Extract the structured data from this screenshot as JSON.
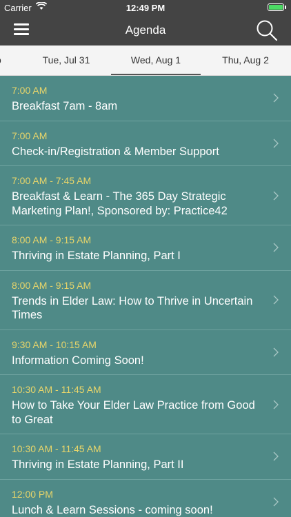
{
  "status_bar": {
    "carrier": "Carrier",
    "time": "12:49 PM"
  },
  "header": {
    "title": "Agenda"
  },
  "date_tabs": {
    "partial": "o",
    "tabs": [
      {
        "label": "Tue, Jul 31",
        "active": false
      },
      {
        "label": "Wed, Aug 1",
        "active": true
      },
      {
        "label": "Thu, Aug 2",
        "active": false
      }
    ]
  },
  "sessions": [
    {
      "time": "7:00 AM",
      "title": "Breakfast 7am - 8am"
    },
    {
      "time": "7:00 AM",
      "title": "Check-in/Registration & Member Support"
    },
    {
      "time": "7:00 AM - 7:45 AM",
      "title": "Breakfast & Learn - The 365 Day Strategic Marketing Plan!, Sponsored by: Practice42"
    },
    {
      "time": "8:00 AM - 9:15 AM",
      "title": "Thriving in Estate Planning, Part I"
    },
    {
      "time": "8:00 AM - 9:15 AM",
      "title": "Trends in Elder Law: How to Thrive in Uncertain Times"
    },
    {
      "time": "9:30 AM - 10:15 AM",
      "title": "Information Coming Soon!"
    },
    {
      "time": "10:30 AM - 11:45 AM",
      "title": "How to Take Your Elder Law Practice from Good to Great"
    },
    {
      "time": "10:30 AM - 11:45 AM",
      "title": "Thriving in Estate Planning, Part II"
    },
    {
      "time": "12:00 PM",
      "title": "Lunch & Learn Sessions - coming soon!"
    }
  ],
  "colors": {
    "list_background": "#4f8a87",
    "time_text": "#e8d56a",
    "header_background": "#444444"
  }
}
